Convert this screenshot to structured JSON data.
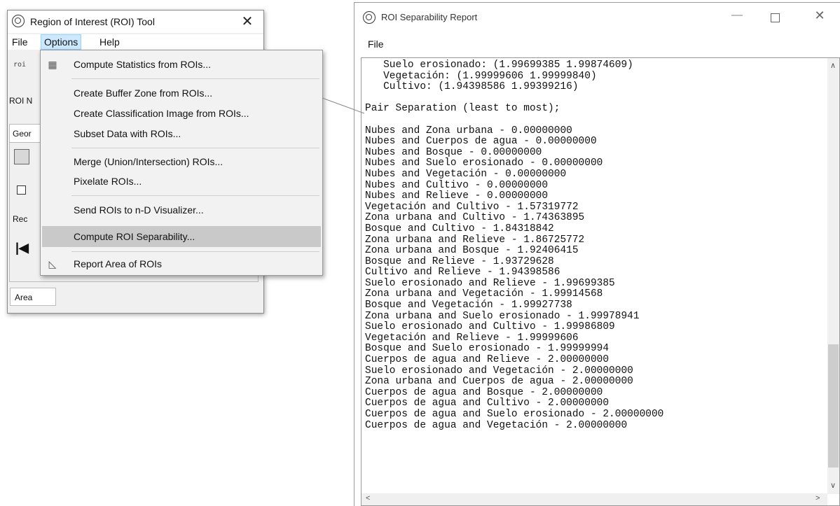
{
  "roi_tool": {
    "title": "Region of Interest (ROI) Tool",
    "close_glyph": "✕",
    "menu": [
      "File",
      "Options",
      "Help"
    ],
    "roi_label_partial": "ROI N",
    "tab_partial": "Geor",
    "rec_partial": "Rec",
    "area_tab": "Area"
  },
  "options_menu": {
    "items": [
      "Compute Statistics from ROIs...",
      "Create Buffer Zone from ROIs...",
      "Create Classification Image from ROIs...",
      "Subset Data with ROIs...",
      "Merge (Union/Intersection) ROIs...",
      "Pixelate ROIs...",
      "Send ROIs to n-D Visualizer...",
      "Compute ROI Separability...",
      "Report Area of ROIs"
    ],
    "highlighted": "Compute ROI Separability..."
  },
  "report": {
    "title": "ROI Separability Report",
    "menu_file": "File",
    "lines": [
      "   Suelo erosionado: (1.99699385 1.99874609)",
      "   Vegetación: (1.99999606 1.99999840)",
      "   Cultivo: (1.94398586 1.99399216)",
      "",
      "Pair Separation (least to most);",
      "",
      "Nubes and Zona urbana - 0.00000000",
      "Nubes and Cuerpos de agua - 0.00000000",
      "Nubes and Bosque - 0.00000000",
      "Nubes and Suelo erosionado - 0.00000000",
      "Nubes and Vegetación - 0.00000000",
      "Nubes and Cultivo - 0.00000000",
      "Nubes and Relieve - 0.00000000",
      "Vegetación and Cultivo - 1.57319772",
      "Zona urbana and Cultivo - 1.74363895",
      "Bosque and Cultivo - 1.84318842",
      "Zona urbana and Relieve - 1.86725772",
      "Zona urbana and Bosque - 1.92406415",
      "Bosque and Relieve - 1.93729628",
      "Cultivo and Relieve - 1.94398586",
      "Suelo erosionado and Relieve - 1.99699385",
      "Zona urbana and Vegetación - 1.99914568",
      "Bosque and Vegetación - 1.99927738",
      "Zona urbana and Suelo erosionado - 1.99978941",
      "Suelo erosionado and Cultivo - 1.99986809",
      "Vegetación and Relieve - 1.99999606",
      "Bosque and Suelo erosionado - 1.99999994",
      "Cuerpos de agua and Relieve - 2.00000000",
      "Suelo erosionado and Vegetación - 2.00000000",
      "Zona urbana and Cuerpos de agua - 2.00000000",
      "Cuerpos de agua and Bosque - 2.00000000",
      "Cuerpos de agua and Cultivo - 2.00000000",
      "Cuerpos de agua and Suelo erosionado - 2.00000000",
      "Cuerpos de agua and Vegetación - 2.00000000"
    ]
  }
}
